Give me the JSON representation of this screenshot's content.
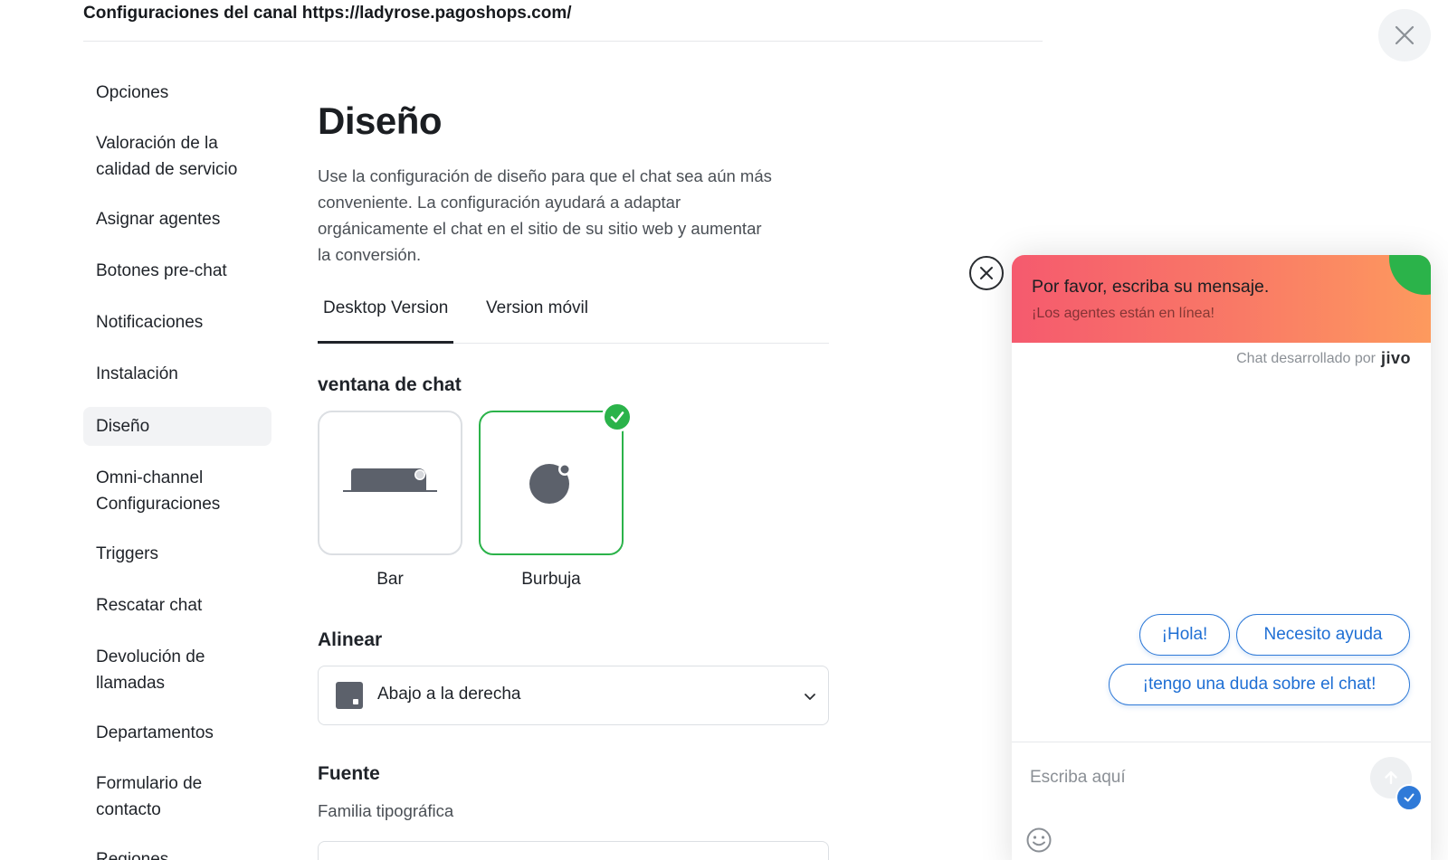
{
  "header": {
    "title": "Configuraciones del canal https://ladyrose.pagoshops.com/"
  },
  "sidebar": {
    "items": [
      {
        "label": "Opciones"
      },
      {
        "label": "Valoración de la calidad de servicio"
      },
      {
        "label": "Asignar agentes"
      },
      {
        "label": "Botones pre-chat"
      },
      {
        "label": "Notificaciones"
      },
      {
        "label": "Instalación"
      },
      {
        "label": "Diseño",
        "active": true
      },
      {
        "label": "Omni-channel Configuraciones"
      },
      {
        "label": "Triggers"
      },
      {
        "label": "Rescatar chat"
      },
      {
        "label": "Devolución de llamadas"
      },
      {
        "label": "Departamentos"
      },
      {
        "label": "Formulario de contacto"
      },
      {
        "label": "Regiones"
      }
    ]
  },
  "main": {
    "title": "Diseño",
    "description": "Use la configuración de diseño para que el chat sea aún más conveniente. La configuración ayudará a adaptar orgánicamente el chat en el sitio de su sitio web y aumentar la conversión.",
    "tabs": [
      {
        "label": "Desktop Version",
        "active": true
      },
      {
        "label": "Version móvil"
      }
    ],
    "chat_window": {
      "title": "ventana de chat",
      "options": [
        {
          "label": "Bar",
          "selected": false
        },
        {
          "label": "Burbuja",
          "selected": true
        }
      ]
    },
    "align": {
      "title": "Alinear",
      "value": "Abajo a la derecha"
    },
    "font": {
      "title": "Fuente",
      "family_label": "Familia tipográfica"
    }
  },
  "widget": {
    "header_title": "Por favor, escriba su mensaje.",
    "header_subtitle": "¡Los agentes están en línea!",
    "powered_by": "Chat desarrollado por",
    "logo_text": "jivo",
    "quick_replies": [
      "¡Hola!",
      "Necesito ayuda",
      "¡tengo una duda sobre el chat!"
    ],
    "input_placeholder": "Escriba aquí"
  },
  "colors": {
    "accent_green": "#2bb34a",
    "accent_blue": "#2f7ad8",
    "header_gradient_start": "#f55a6e",
    "header_gradient_end": "#fd9a5e"
  }
}
